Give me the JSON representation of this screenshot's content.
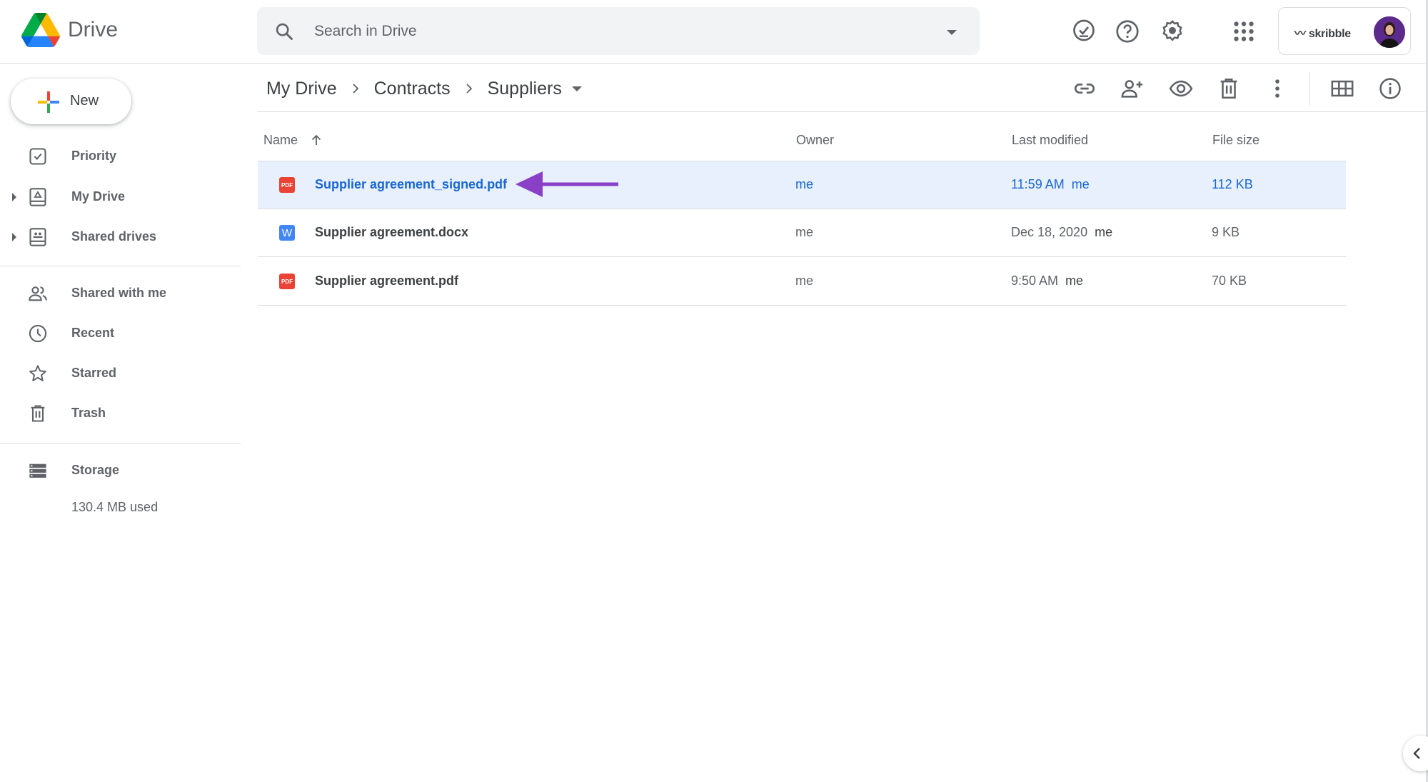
{
  "header": {
    "app_title": "Drive",
    "search": {
      "placeholder": "Search in Drive",
      "value": ""
    },
    "icons": [
      "ready-for-offline-icon",
      "help-icon",
      "settings-icon",
      "apps-grid-icon"
    ],
    "account": {
      "brand": "skribble",
      "avatar": "avatar"
    }
  },
  "sidebar": {
    "new_label": "New",
    "items": [
      {
        "label": "Priority",
        "icon": "priority-icon",
        "expandable": false
      },
      {
        "label": "My Drive",
        "icon": "my-drive-icon",
        "expandable": true
      },
      {
        "label": "Shared drives",
        "icon": "shared-drives-icon",
        "expandable": true
      },
      {
        "label": "Shared with me",
        "icon": "shared-with-me-icon",
        "expandable": false
      },
      {
        "label": "Recent",
        "icon": "clock-icon",
        "expandable": false
      },
      {
        "label": "Starred",
        "icon": "star-icon",
        "expandable": false
      },
      {
        "label": "Trash",
        "icon": "trash-icon",
        "expandable": false
      }
    ],
    "storage": {
      "label": "Storage",
      "used": "130.4 MB used"
    }
  },
  "breadcrumb": [
    "My Drive",
    "Contracts",
    "Suppliers"
  ],
  "toolbar": {
    "icons": [
      "get-link-icon",
      "share-icon",
      "preview-icon",
      "remove-icon",
      "more-actions-icon",
      "grid-view-icon",
      "view-details-icon"
    ]
  },
  "table": {
    "columns": {
      "name": "Name",
      "owner": "Owner",
      "modified": "Last modified",
      "size": "File size"
    },
    "sort": {
      "column": "Name",
      "direction": "ascending"
    },
    "rows": [
      {
        "type": "pdf",
        "type_label": "PDF",
        "name": "Supplier agreement_signed.pdf",
        "owner": "me",
        "modified": "11:59 AM",
        "modified_by": "me",
        "size": "112 KB",
        "selected": true
      },
      {
        "type": "word",
        "type_label": "W",
        "name": "Supplier agreement.docx",
        "owner": "me",
        "modified": "Dec 18, 2020",
        "modified_by": "me",
        "size": "9 KB",
        "selected": false
      },
      {
        "type": "pdf",
        "type_label": "PDF",
        "name": "Supplier agreement.pdf",
        "owner": "me",
        "modified": "9:50 AM",
        "modified_by": "me",
        "size": "70 KB",
        "selected": false
      }
    ]
  },
  "annotation": {
    "type": "arrow",
    "color": "#8a3fc7",
    "points_to": "Supplier agreement_signed.pdf"
  },
  "colors": {
    "selected_row_bg": "#e8f0fe",
    "selected_text": "#1967d2",
    "pdf_red": "#ea4335",
    "word_blue": "#4285f4"
  }
}
